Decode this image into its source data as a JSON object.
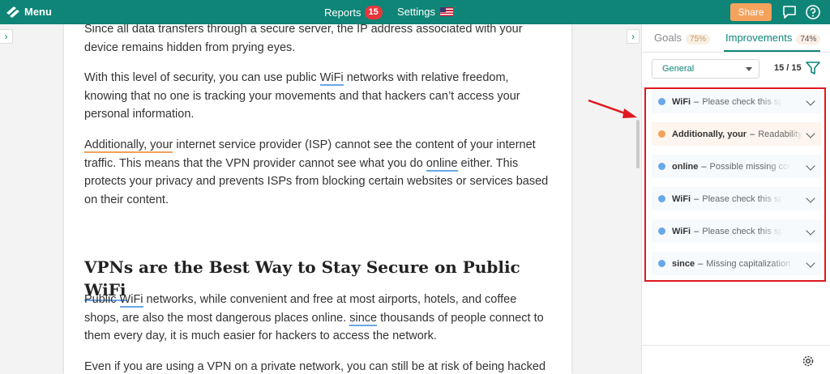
{
  "topbar": {
    "menu_label": "Menu",
    "reports_label": "Reports",
    "reports_count": "15",
    "settings_label": "Settings",
    "share_label": "Share"
  },
  "document": {
    "p1": {
      "text": "Since all data transfers through a secure server, the IP address associated with your device remains hidden from prying eyes."
    },
    "p2": {
      "before": "With this level of security, you can use public ",
      "flag": "WiFi",
      "after": " networks with relative freedom, knowing that no one is tracking your movements and that hackers can’t access your personal information."
    },
    "p3": {
      "flag": "Additionally, your",
      "mid": " internet service provider (ISP) cannot see the content of your internet traffic. This means that the VPN provider cannot see what you do ",
      "flag2": "online",
      "after": " either. This protects your privacy and prevents ISPs from blocking certain websites or services based on their content."
    },
    "heading": {
      "before": "VPNs are the Best Way to Stay Secure on Public ",
      "flag": "WiFi"
    },
    "p4": {
      "before": "Public ",
      "flag": "WiFi",
      "mid": " networks, while convenient and free at most airports, hotels, and coffee shops, are also the most dangerous places online. ",
      "flag2": "since",
      "after": " thousands of people connect to them every day, it is much easier for hackers to access the network."
    },
    "p5": {
      "text": "Even if you are using a VPN on a private network, you can still be at risk of being hacked"
    }
  },
  "panel": {
    "tab_goals": "Goals",
    "goals_pct": "75%",
    "tab_improvements": "Improvements",
    "improvements_pct": "74%",
    "dropdown_value": "General",
    "count": "15 / 15",
    "items": [
      {
        "word": "WiFi",
        "msg": "Please check this spelling",
        "color": "#6aa7e8"
      },
      {
        "word": "Additionally, your",
        "msg": "Readability",
        "color": "#f0a35a"
      },
      {
        "word": "online",
        "msg": "Possible missing comma",
        "color": "#6aa7e8"
      },
      {
        "word": "WiFi",
        "msg": "Please check this spelling",
        "color": "#6aa7e8"
      },
      {
        "word": "WiFi",
        "msg": "Please check this spelling",
        "color": "#6aa7e8"
      },
      {
        "word": "since",
        "msg": "Missing capitalization",
        "color": "#6aa7e8"
      }
    ]
  },
  "colors": {
    "brand": "#0e8577",
    "share": "#f5a25d",
    "badge": "#e8373c",
    "highlight_box": "#e0181f"
  },
  "icons": [
    "logo-icon",
    "chat-icon",
    "help-icon",
    "chevron-right-icon",
    "filter-icon",
    "chevron-down-icon",
    "gear-icon"
  ]
}
